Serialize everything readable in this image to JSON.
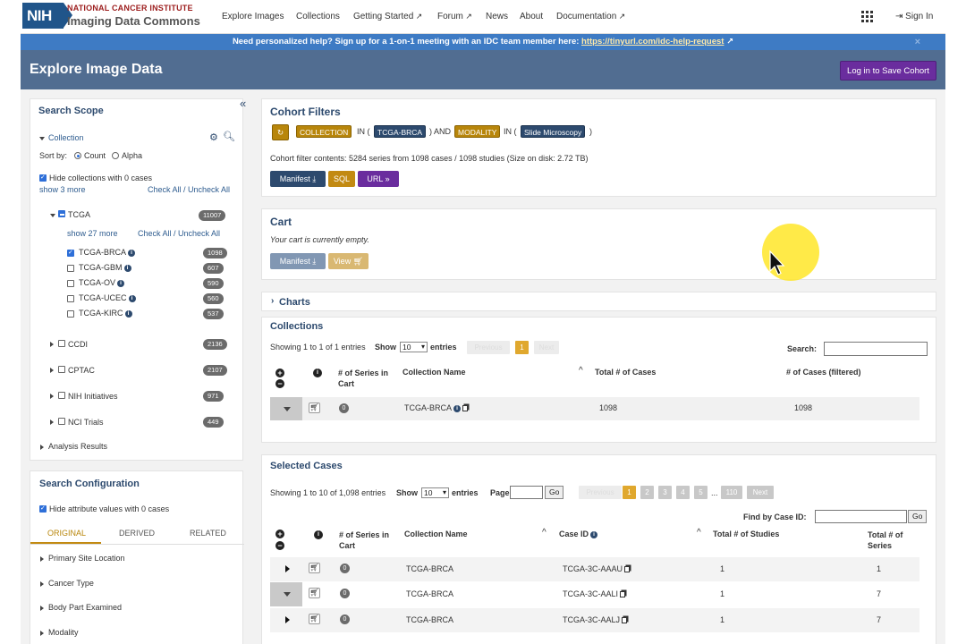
{
  "nav": {
    "brand_line1": "NATIONAL CANCER INSTITUTE",
    "brand_line2": "Imaging Data Commons",
    "logo": "NIH",
    "items": [
      "Explore Images",
      "Collections",
      "Getting Started",
      "Forum",
      "News",
      "About",
      "Documentation"
    ],
    "sign_in": "Sign In"
  },
  "banner": {
    "text": "Need personalized help? Sign up for a 1-on-1 meeting with an IDC team member here: ",
    "link": "https://tinyurl.com/idc-help-request",
    "close": "×"
  },
  "header": {
    "title": "Explore Image Data",
    "save_button": "Log in to Save Cohort"
  },
  "scope": {
    "title": "Search Scope",
    "collapse": "«",
    "collection_label": "Collection",
    "sort_by": "Sort by:",
    "sort_count": "Count",
    "sort_alpha": "Alpha",
    "hide_zero": "Hide collections with 0 cases",
    "show_more": "show 3 more",
    "check_all": "Check All / Uncheck All",
    "tcga": {
      "label": "TCGA",
      "count": "11007",
      "show_more": "show 27 more",
      "check_all": "Check All / Uncheck All"
    },
    "tcga_items": [
      {
        "label": "TCGA-BRCA",
        "count": "1098",
        "checked": true
      },
      {
        "label": "TCGA-GBM",
        "count": "607",
        "checked": false
      },
      {
        "label": "TCGA-OV",
        "count": "590",
        "checked": false
      },
      {
        "label": "TCGA-UCEC",
        "count": "560",
        "checked": false
      },
      {
        "label": "TCGA-KIRC",
        "count": "537",
        "checked": false
      }
    ],
    "groups": [
      {
        "label": "CCDI",
        "count": "2136"
      },
      {
        "label": "CPTAC",
        "count": "2107"
      },
      {
        "label": "NIH Initiatives",
        "count": "971"
      },
      {
        "label": "NCI Trials",
        "count": "449"
      }
    ],
    "analysis": "Analysis Results"
  },
  "config": {
    "title": "Search Configuration",
    "hide_zero": "Hide attribute values with 0 cases",
    "tabs": [
      "ORIGINAL",
      "DERIVED",
      "RELATED"
    ],
    "items": [
      "Primary Site Location",
      "Cancer Type",
      "Body Part Examined",
      "Modality"
    ]
  },
  "filters": {
    "title": "Cohort Filters",
    "key1": "COLLECTION",
    "in1": "IN (",
    "val1": "TCGA-BRCA",
    "and": ") AND",
    "key2": "MODALITY",
    "in2": "IN (",
    "val2": "Slide Microscopy",
    "close": ")",
    "contents": "Cohort filter contents: 5284 series from 1098 cases / 1098 studies (Size on disk: 2.72 TB)",
    "btn_manifest": "Manifest",
    "btn_sql": "SQL",
    "btn_url": "URL »"
  },
  "cart": {
    "title": "Cart",
    "empty": "Your cart is currently empty.",
    "btn_manifest": "Manifest",
    "btn_view": "View"
  },
  "charts": {
    "title": "Charts"
  },
  "collections": {
    "title": "Collections",
    "showing": "Showing 1 to 1 of 1 entries",
    "show": "Show",
    "show_value": "10",
    "entries": "entries",
    "prev": "Previous",
    "page": "1",
    "next": "Next",
    "search": "Search:",
    "headers": [
      "# of Series in Cart",
      "Collection Name",
      "Total # of Cases",
      "# of Cases (filtered)"
    ],
    "row": {
      "series": "0",
      "name": "TCGA-BRCA",
      "total": "1098",
      "filtered": "1098"
    }
  },
  "cases": {
    "title": "Selected Cases",
    "showing": "Showing 1 to 10 of 1,098 entries",
    "show": "Show",
    "show_value": "10",
    "entries": "entries",
    "page_label": "Page",
    "go": "Go",
    "prev": "Previous",
    "pages": [
      "1",
      "2",
      "3",
      "4",
      "5"
    ],
    "ellipsis": "...",
    "last": "110",
    "next": "Next",
    "find": "Find by Case ID:",
    "headers": [
      "# of Series in Cart",
      "Collection Name",
      "Case ID",
      "Total # of Studies",
      "Total # of Series"
    ],
    "rows": [
      {
        "series": "0",
        "collection": "TCGA-BRCA",
        "case": "TCGA-3C-AAAU",
        "studies": "1",
        "total": "1"
      },
      {
        "series": "0",
        "collection": "TCGA-BRCA",
        "case": "TCGA-3C-AALI",
        "studies": "1",
        "total": "7"
      },
      {
        "series": "0",
        "collection": "TCGA-BRCA",
        "case": "TCGA-3C-AALJ",
        "studies": "1",
        "total": "7"
      }
    ]
  },
  "colors": {
    "accent_gold": "#c28a12",
    "navy": "#2d4a6e",
    "header": "#516d91",
    "banner": "#3e7bc4",
    "purple": "#6a2d9e"
  }
}
